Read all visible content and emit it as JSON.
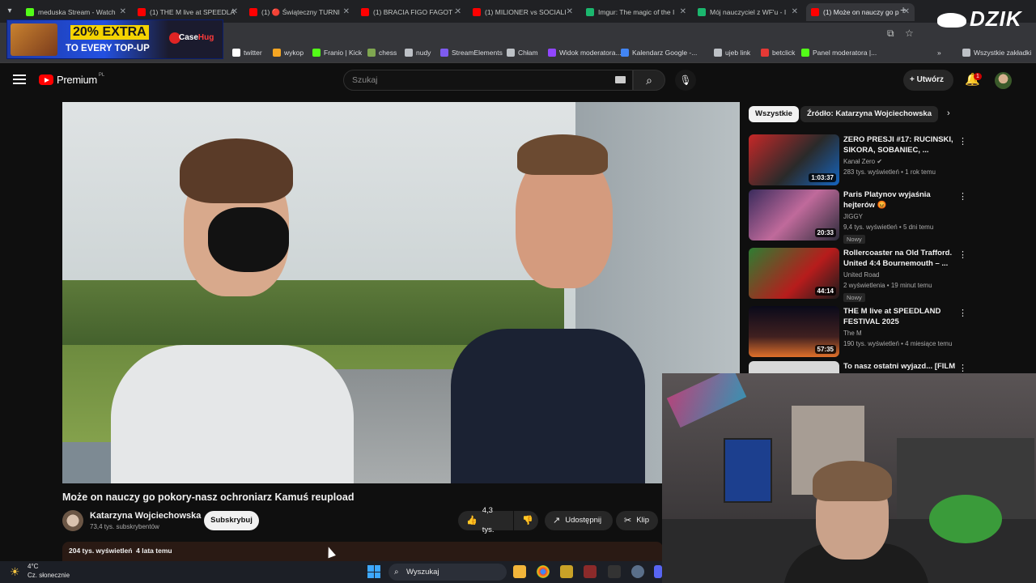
{
  "browser": {
    "tabs": [
      {
        "title": "meduska Stream - Watch",
        "color": "#53fc18"
      },
      {
        "title": "(1) THE M live at SPEEDLA",
        "color": "#ff0000"
      },
      {
        "title": "(1) 🔴 Świąteczny TURNI",
        "color": "#ff0000"
      },
      {
        "title": "(1) BRACIA FIGO FAGOT -",
        "color": "#ff0000"
      },
      {
        "title": "(1) MILIONER vs SOCIALI",
        "color": "#ff0000"
      },
      {
        "title": "Imgur: The magic of the I",
        "color": "#1bb76e"
      },
      {
        "title": "Mój nauczyciel z WF'u - I",
        "color": "#1bb76e"
      },
      {
        "title": "(1) Może on nauczy go p",
        "color": "#ff0000"
      }
    ],
    "bookmarks": [
      {
        "label": "twitter",
        "color": "#ffffff"
      },
      {
        "label": "wykop",
        "color": "#f5a623"
      },
      {
        "label": "Franio | Kick",
        "color": "#53fc18"
      },
      {
        "label": "chess",
        "color": "#7fa650"
      },
      {
        "label": "nudy",
        "color": "#bdc1c6"
      },
      {
        "label": "StreamElements",
        "color": "#7e5bef"
      },
      {
        "label": "Chłam",
        "color": "#bdc1c6"
      },
      {
        "label": "Widok moderatora...",
        "color": "#9146ff"
      },
      {
        "label": "Kalendarz Google -...",
        "color": "#4285f4"
      },
      {
        "label": "ujeb link",
        "color": "#bdc1c6"
      },
      {
        "label": "betclick",
        "color": "#e53935"
      },
      {
        "label": "Panel moderatora |...",
        "color": "#53fc18"
      }
    ],
    "all_bookmarks": "Wszystkie zakładki"
  },
  "ad": {
    "line1": "20% EXTRA",
    "line2": "TO EVERY TOP-UP",
    "brand_a": "Case",
    "brand_b": "Hug"
  },
  "overlay_logo": "DZIK",
  "youtube": {
    "logo_text": "Premium",
    "region": "PL",
    "search_placeholder": "Szukaj",
    "create_label": "Utwórz",
    "notification_count": "1"
  },
  "video": {
    "title": "Może on nauczy go pokory-nasz ochroniarz Kamuś reupload",
    "channel": "Katarzyna Wojciechowska",
    "subscribers": "73,4 tys. subskrybentów",
    "subscribe_label": "Subskrybuj",
    "likes": "4,3 tys.",
    "share_label": "Udostępnij",
    "clip_label": "Klip",
    "views": "204 tys. wyświetleń",
    "age": "4 lata temu"
  },
  "sidebar": {
    "chips": [
      "Wszystkie",
      "Źródło: Katarzyna Wojciechowska"
    ],
    "recommendations": [
      {
        "title": "ZERO PRESJI #17: RUCINSKI, SIKORA, SOBANIEC, ...",
        "channel": "Kanał Zero",
        "meta": "283 tys. wyświetleń • 1 rok temu",
        "duration": "1:03:37",
        "badge": ""
      },
      {
        "title": "Paris Platynov wyjaśnia hejterów 😡",
        "channel": "JIGGY",
        "meta": "9,4 tys. wyświetleń • 5 dni temu",
        "duration": "20:33",
        "badge": "Nowy"
      },
      {
        "title": "Rollercoaster na Old Trafford. United 4:4 Bournemouth – ...",
        "channel": "United Road",
        "meta": "2 wyświetlenia • 19 minut temu",
        "duration": "44:14",
        "badge": "Nowy"
      },
      {
        "title": "THE M live at SPEEDLAND FESTIVAL 2025",
        "channel": "The M",
        "meta": "190 tys. wyświetleń • 4 miesiące temu",
        "duration": "57:35",
        "badge": ""
      },
      {
        "title": "To nasz ostatni wyjazd... [FILM",
        "channel": "",
        "meta": "",
        "duration": "",
        "badge": ""
      }
    ]
  },
  "taskbar": {
    "temperature": "4°C",
    "weather": "Cz. słonecznie",
    "search_label": "Wyszukaj"
  }
}
